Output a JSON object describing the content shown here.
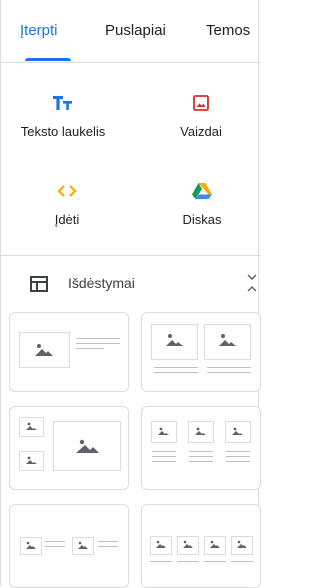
{
  "tabs": [
    {
      "label": "Įterpti",
      "active": true
    },
    {
      "label": "Puslapiai",
      "active": false
    },
    {
      "label": "Temos",
      "active": false
    }
  ],
  "insert": {
    "items": [
      {
        "label": "Teksto laukelis",
        "icon": "text-box-icon",
        "color": "#1a73e8"
      },
      {
        "label": "Vaizdai",
        "icon": "image-icon",
        "color": "#d93025"
      },
      {
        "label": "Įdėti",
        "icon": "embed-icon",
        "color": "#f9ab00"
      },
      {
        "label": "Diskas",
        "icon": "google-drive-icon",
        "color": "#0f9d58"
      }
    ]
  },
  "layouts": {
    "title": "Išdėstymai",
    "expanded": true
  },
  "colors": {
    "accent": "#1a73e8",
    "border": "#dadce0",
    "placeholder_icon": "#5f6368"
  }
}
